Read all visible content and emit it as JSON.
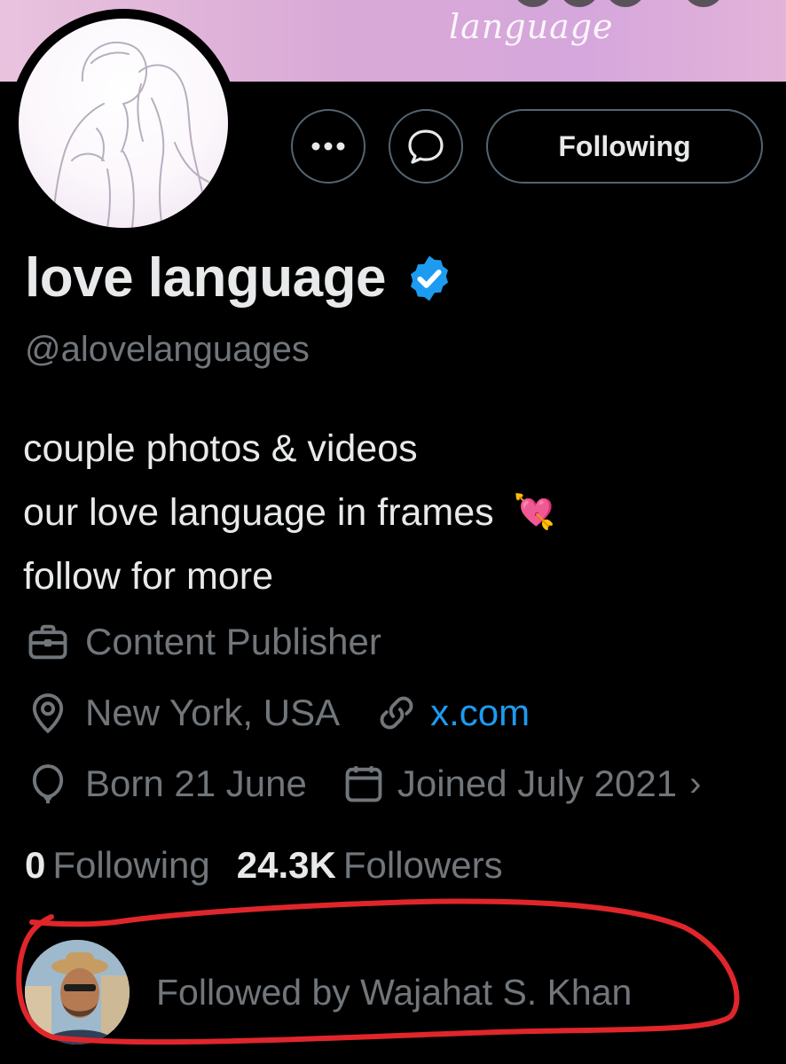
{
  "banner": {
    "word": "language"
  },
  "actions": {
    "more_label": "•••",
    "following_label": "Following"
  },
  "profile": {
    "name": "love language",
    "handle": "@alovelanguages",
    "bio_lines": [
      "couple photos & videos",
      "our love language in frames",
      "follow for more"
    ],
    "bio_emoji": "💘",
    "category": "Content Publisher",
    "location": "New York, USA",
    "website": "x.com",
    "birthday": "Born 21 June",
    "joined": "Joined July 2021",
    "overflow_chevron": "›"
  },
  "stats": {
    "following_count": "0",
    "following_label": "Following",
    "followers_count": "24.3K",
    "followers_label": "Followers"
  },
  "followed_by": {
    "text": "Followed by Wajahat S. Khan"
  },
  "colors": {
    "background": "#000000",
    "text_primary": "#e7e9ea",
    "text_secondary": "#71767b",
    "accent": "#1d9bf0",
    "border": "#536471",
    "annotation": "#e0262b"
  },
  "icons": [
    "more-icon",
    "message-icon",
    "verified-badge-icon",
    "briefcase-icon",
    "location-pin-icon",
    "link-icon",
    "balloon-icon",
    "calendar-icon"
  ]
}
